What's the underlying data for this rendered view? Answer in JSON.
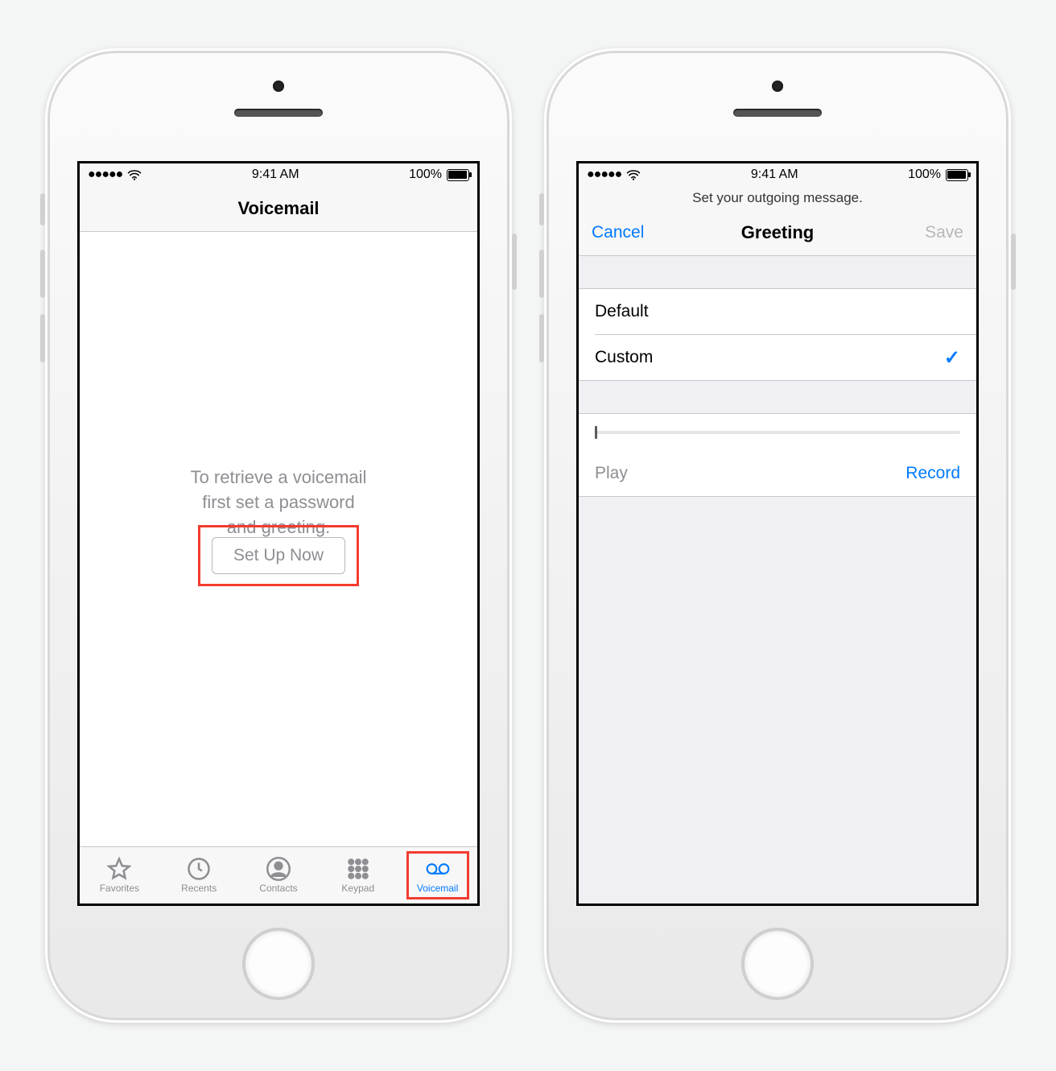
{
  "statusbar": {
    "signal": "●●●●●",
    "wifi": "wifi-icon",
    "time": "9:41 AM",
    "battery_pct": "100%"
  },
  "left_phone": {
    "navbar_title": "Voicemail",
    "empty_line1": "To retrieve a voicemail",
    "empty_line2": "first set a password",
    "empty_line3": "and greeting.",
    "setup_button": "Set Up Now",
    "tabs": [
      {
        "label": "Favorites",
        "icon": "star-icon"
      },
      {
        "label": "Recents",
        "icon": "clock-icon"
      },
      {
        "label": "Contacts",
        "icon": "person-icon"
      },
      {
        "label": "Keypad",
        "icon": "keypad-icon"
      },
      {
        "label": "Voicemail",
        "icon": "voicemail-icon"
      }
    ],
    "active_tab_index": 4,
    "highlighted_tab_index": 4,
    "setup_highlighted": true
  },
  "right_phone": {
    "prompt": "Set your outgoing message.",
    "nav_left": "Cancel",
    "nav_title": "Greeting",
    "nav_right": "Save",
    "nav_right_enabled": false,
    "options": [
      {
        "label": "Default",
        "selected": false
      },
      {
        "label": "Custom",
        "selected": true
      }
    ],
    "scrubber_position": 0,
    "play_label": "Play",
    "record_label": "Record"
  },
  "highlight_color": "#f33b2f"
}
